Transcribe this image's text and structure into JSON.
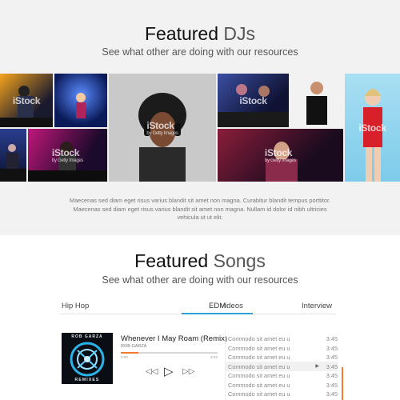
{
  "featured_djs": {
    "title_main": "Featured",
    "title_accent": "DJs",
    "subtitle": "See what other are doing with our resources",
    "watermark": "iStock",
    "watermark_sub": "by Getty Images",
    "description": "Maecenas sed diam eget risus varius blandit sit amet non magna. Curabitur blandit tempus porttitor. Maecenas sed diam eget risus varius blandit sit amet non magna. Nullam id dolor id nibh ultricies vehicula ut ut elit."
  },
  "featured_songs": {
    "title_main": "Featured",
    "title_accent": "Songs",
    "subtitle": "See what other are doing with our resources",
    "tabs": [
      "Hip Hop",
      "EDM",
      "Videos",
      "Interview"
    ],
    "active_tab": "EDM"
  },
  "player": {
    "cover_artist": "ROB GARZA",
    "cover_title": "REMIXES",
    "song_title": "Whenever I May Roam (Remix)",
    "artist": "ROB GARZA",
    "time_current": "0:00",
    "time_total": "3:03",
    "progress": 0.18,
    "accent_color": "#f07a2e",
    "tab_color": "#2aa3d6",
    "controls": {
      "prev": "prev-icon",
      "play": "play-icon",
      "next": "next-icon"
    }
  },
  "playlist": [
    {
      "name": "Commodo sit amet eu u",
      "time": "3:45"
    },
    {
      "name": "Commodo sit amet eu u",
      "time": "3:45"
    },
    {
      "name": "Commodo sit amet eu u",
      "time": "3:45"
    },
    {
      "name": "Commodo sit amet eu u",
      "time": "3:45",
      "active": true
    },
    {
      "name": "Commodo sit amet eu u",
      "time": "3:45"
    },
    {
      "name": "Commodo sit amet eu u",
      "time": "3:45"
    },
    {
      "name": "Commodo sit amet eu u",
      "time": "3:45"
    }
  ]
}
